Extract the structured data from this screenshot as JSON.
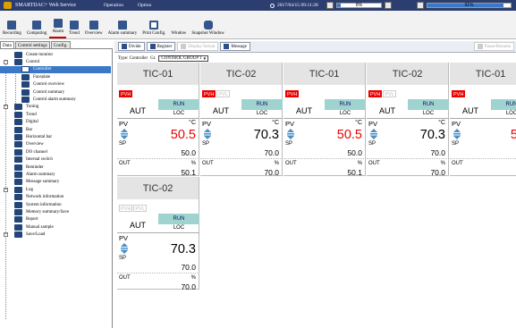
{
  "menubar": {
    "title": "SMARTDAC+ Web Service",
    "items": [
      "Operation",
      "Option"
    ],
    "datetime": "2017/04/15 09:11:28",
    "meter1_pct": "8%",
    "meter1_value": 0.08,
    "meter2_pct": "91%",
    "meter2_value": 0.91
  },
  "toolbar": [
    {
      "label": "Recording",
      "icon": "record-icon"
    },
    {
      "label": "Computing",
      "icon": "compute-icon"
    },
    {
      "label": "Alarm",
      "icon": "alarm-icon"
    },
    {
      "label": "Trend",
      "icon": "trend-icon"
    },
    {
      "label": "Overview",
      "icon": "overview-icon"
    },
    {
      "label": "Alarm summary",
      "icon": "alarm-summary-icon"
    },
    {
      "label": "Print Config.",
      "icon": "print-icon"
    },
    {
      "label": "Window",
      "icon": "window-icon"
    },
    {
      "label": "Snapshot Window",
      "icon": "camera-icon"
    }
  ],
  "sidetabs": [
    "Data",
    "Control settings",
    "Config."
  ],
  "tree": [
    "Create monitor",
    "Control",
    "Controller",
    "Faceplate",
    "Control overview",
    "Control summary",
    "Control alarm summary",
    "Tuning",
    "Trend",
    "Digital",
    "Bar",
    "Horizontal bar",
    "Overview",
    "DO channel",
    "Internal switch",
    "Reminder",
    "Alarm summary",
    "Message summary",
    "Log",
    "Network information",
    "System information",
    "Memory summary/Save",
    "Report",
    "Manual sample",
    "Save/Load"
  ],
  "main": {
    "buttons": {
      "divide": "Divide",
      "register": "Register",
      "display_format": "Display format",
      "message": "Message",
      "pause": "Pause/Resume"
    },
    "type_label": "Type: Controller",
    "gr_label": "Gr.",
    "group": "CONTROL GROUP 1"
  },
  "cards": [
    {
      "tag": "TIC-01",
      "alm1": "PVH",
      "alm2": "",
      "mode": "AUT",
      "run": "RUN",
      "loc": "LOC",
      "pv_label": "PV",
      "unit": "°C",
      "pv": "50.5",
      "sp_label": "SP",
      "sp": "50.0",
      "out_label": "OUT",
      "out_unit": "%",
      "out": "50.1"
    },
    {
      "tag": "TIC-02",
      "alm1": "PVH",
      "alm2": "PVL",
      "mode": "AUT",
      "run": "RUN",
      "loc": "LOC",
      "pv_label": "PV",
      "unit": "°C",
      "pv": "70.3",
      "sp_label": "SP",
      "sp": "70.0",
      "out_label": "OUT",
      "out_unit": "%",
      "out": "70.0"
    },
    {
      "tag": "TIC-01",
      "alm1": "PVH",
      "alm2": "",
      "mode": "AUT",
      "run": "RUN",
      "loc": "LOC",
      "pv_label": "PV",
      "unit": "°C",
      "pv": "50.5",
      "sp_label": "SP",
      "sp": "50.0",
      "out_label": "OUT",
      "out_unit": "%",
      "out": "50.1"
    },
    {
      "tag": "TIC-02",
      "alm1": "PVH",
      "alm2": "PVL",
      "mode": "AUT",
      "run": "RUN",
      "loc": "LOC",
      "pv_label": "PV",
      "unit": "°C",
      "pv": "70.3",
      "sp_label": "SP",
      "sp": "70.0",
      "out_label": "OUT",
      "out_unit": "%",
      "out": "70.0"
    },
    {
      "tag": "TIC-01",
      "alm1": "PVH",
      "alm2": "",
      "mode": "AUT",
      "run": "RUN",
      "loc": "LOC",
      "pv_label": "PV",
      "unit": "°",
      "pv": "50.",
      "sp_label": "SP",
      "sp": "50.",
      "out_label": "OUT",
      "out_unit": "",
      "out": "50."
    },
    {
      "tag": "TIC-02",
      "alm1": "PVH",
      "alm2": "PVL",
      "mode": "AUT",
      "run": "RUN",
      "loc": "LOC",
      "pv_label": "PV",
      "unit": "",
      "pv": "70.3",
      "sp_label": "SP",
      "sp": "70.0",
      "out_label": "OUT",
      "out_unit": "%",
      "out": "70.0"
    }
  ]
}
